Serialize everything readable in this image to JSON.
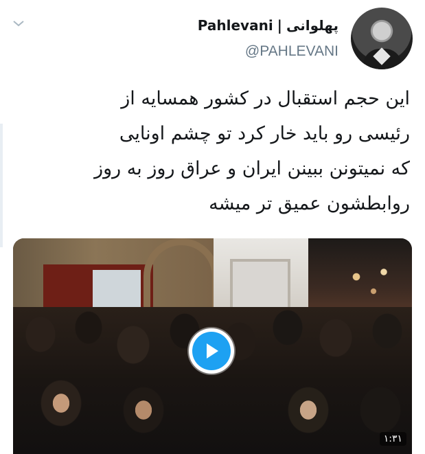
{
  "tweet": {
    "display_name_fa": "پهلوانی",
    "separator": "|",
    "display_name_en": "Pahlevani",
    "handle": "@PAHLEVANI",
    "text_lines": [
      "این حجم استقبال در کشور همسایه از",
      "رئیسی رو باید خار کرد تو چشم اونایی",
      "که نمیتونن ببینن ایران و عراق روز به روز",
      "روابطشون عمیق تر میشه"
    ],
    "media": {
      "duration": "۱:۳۱"
    }
  },
  "icons": {
    "menu": "chevron-down-icon",
    "play": "play-icon"
  },
  "colors": {
    "accent": "#1da1f2",
    "text": "#14171a",
    "secondary": "#657786"
  }
}
